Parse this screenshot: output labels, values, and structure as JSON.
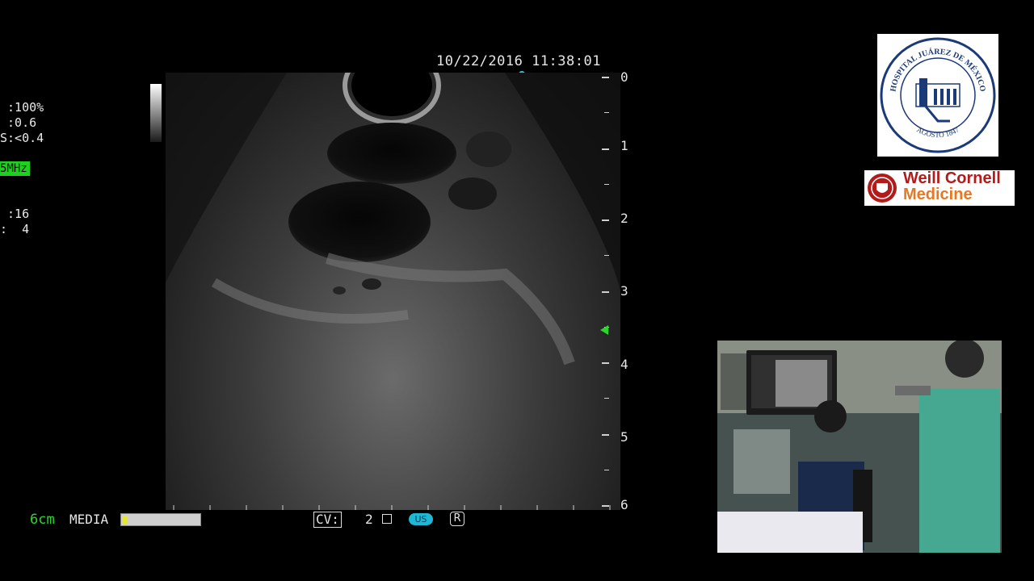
{
  "header": {
    "datetime": "10/22/2016 11:38:01"
  },
  "params": {
    "line1": " :100%",
    "line2": " :0.6",
    "line3": "S:<0.4",
    "frequency": "5MHz",
    "line5": " :16",
    "line6": ":  4"
  },
  "depth_scale": {
    "labels": [
      "0",
      "1",
      "2",
      "3",
      "4",
      "5",
      "6"
    ]
  },
  "footer": {
    "depth": "6cm",
    "mode": "MEDIA",
    "media_progress": 0.06,
    "cv_label": "CV:",
    "cv_value": "2",
    "us_badge": "US",
    "r_badge": "R"
  },
  "logos": {
    "hospital_top": "HOSPITAL JUÁREZ DE MÉXICO",
    "hospital_bottom": "AGOSTO 1847",
    "weill_line1": "Weill Cornell",
    "weill_line2": "Medicine"
  },
  "colors": {
    "accent_green": "#2ad82a",
    "marker_cyan": "#22c8e8",
    "weill_red": "#b31b1b",
    "weill_orange": "#e87722"
  }
}
